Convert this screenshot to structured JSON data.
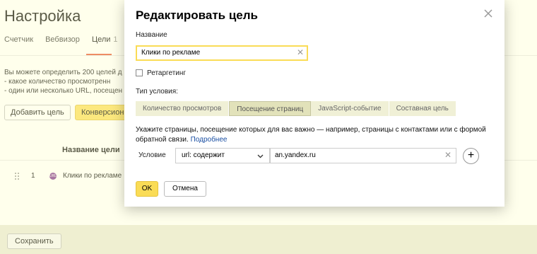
{
  "background": {
    "page_title": "Настройка",
    "tabs": [
      {
        "label": "Счетчик"
      },
      {
        "label": "Вебвизор"
      },
      {
        "label": "Цели",
        "count": "1"
      }
    ],
    "info_lines": [
      "Вы можете определить 200 целей д",
      "- какое количество просмотренн",
      "- один или несколько URL, посещен"
    ],
    "add_goal_button": "Добавить цель",
    "conversion_button": "Конверсион",
    "column_header": "Название цели",
    "goals": [
      {
        "num": "1",
        "icon_text": "URL",
        "name": "Клики по рекламе"
      }
    ],
    "save_button": "Сохранить"
  },
  "modal": {
    "title": "Редактировать цель",
    "name_label": "Название",
    "name_value": "Клики по рекламе",
    "retargeting_label": "Ретаргетинг",
    "condition_type_label": "Тип условия:",
    "condition_types": [
      {
        "label": "Количество просмотров",
        "active": false
      },
      {
        "label": "Посещение страниц",
        "active": true
      },
      {
        "label": "JavaScript-событие",
        "active": false
      },
      {
        "label": "Составная цель",
        "active": false
      }
    ],
    "hint_text": "Укажите страницы, посещение которых для вас важно — например, страницы с контактами или с формой обратной связи.",
    "hint_link": "Подробнее",
    "condition_label": "Условие",
    "condition_select": "url: содержит",
    "condition_value": "an.yandex.ru",
    "ok_button": "OK",
    "cancel_button": "Отмена"
  },
  "colors": {
    "accent_yellow": "#fadc56",
    "link_blue": "#1a4fa3",
    "tab_underline": "#e54f2f"
  },
  "icons": [
    "close-icon",
    "clear-icon",
    "chevron-down-icon",
    "plus-icon",
    "drag-handle-icon",
    "url-goal-icon"
  ]
}
